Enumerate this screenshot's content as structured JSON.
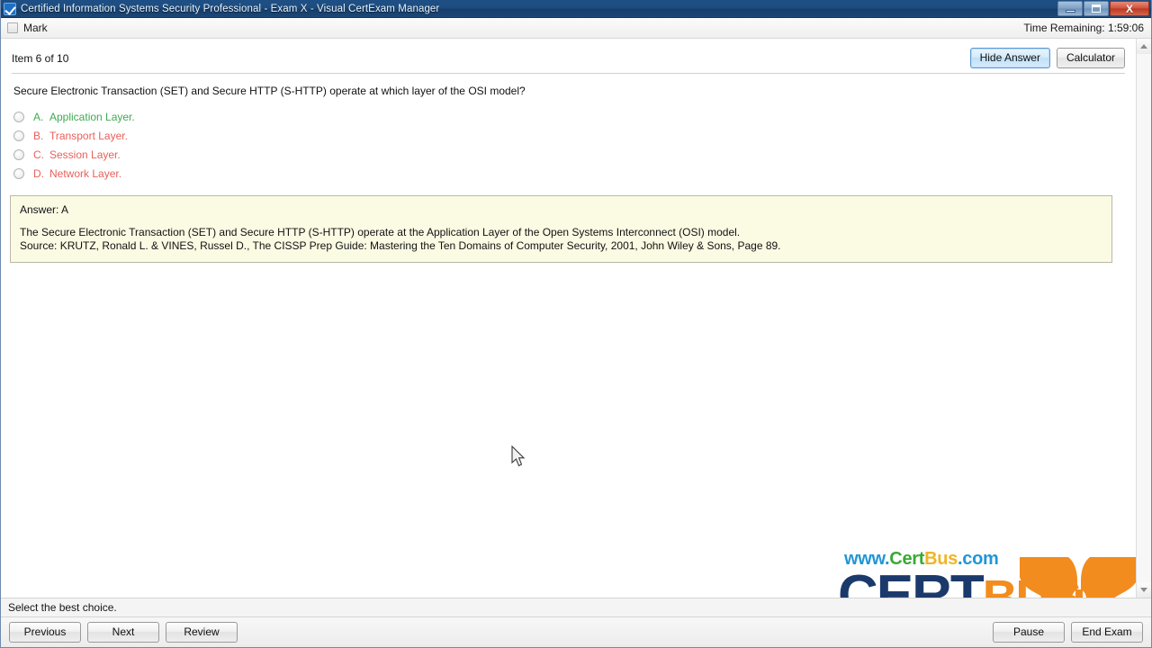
{
  "window": {
    "title": "Certified Information Systems Security Professional - Exam X - Visual CertExam Manager",
    "app_icon": "checkbox-icon",
    "minimize_label": "Minimize",
    "maximize_label": "Restore",
    "close_label": "X"
  },
  "toolbar": {
    "mark_label": "Mark",
    "time_remaining": "Time Remaining: 1:59:06"
  },
  "exam": {
    "item_counter": "Item 6 of 10",
    "hide_answer_label": "Hide Answer",
    "calculator_label": "Calculator",
    "question": "Secure Electronic Transaction (SET) and Secure HTTP (S-HTTP) operate at which layer of the OSI model?",
    "options": [
      {
        "letter": "A.",
        "text": "Application Layer.",
        "state": "correct",
        "color": "#3faa52",
        "selected": false
      },
      {
        "letter": "B.",
        "text": "Transport Layer.",
        "state": "wrong",
        "color": "#e8615c",
        "selected": false
      },
      {
        "letter": "C.",
        "text": "Session Layer.",
        "state": "wrong",
        "color": "#e8615c",
        "selected": false
      },
      {
        "letter": "D.",
        "text": "Network Layer.",
        "state": "wrong",
        "color": "#e8615c",
        "selected": false
      }
    ],
    "answer": {
      "heading": "Answer: A",
      "explanation": "The Secure Electronic Transaction (SET) and Secure HTTP (S-HTTP) operate at the Application Layer of the Open Systems Interconnect (OSI) model.",
      "source": "Source: KRUTZ, Ronald L. & VINES, Russel D., The CISSP Prep Guide: Mastering the Ten Domains of Computer Security, 2001, John Wiley & Sons, Page 89.",
      "background": "#fbfbe4",
      "border": "#b9b9a8"
    }
  },
  "logo": {
    "url_www": "www.",
    "url_cert": "Cert",
    "url_bus": "Bus",
    "url_com": ".com",
    "word_cert": "CERT",
    "word_bus": "BUS",
    "colors": {
      "url_www": "#2196d6",
      "url_cert": "#3aa935",
      "url_bus": "#f0b429",
      "url_com": "#2196d6",
      "word_cert": "#1b3a6b",
      "word_bus": "#f28c1e",
      "mark": "#f28c1e"
    }
  },
  "status": {
    "hint": "Select the best choice."
  },
  "nav": {
    "previous_label": "Previous",
    "next_label": "Next",
    "review_label": "Review",
    "pause_label": "Pause",
    "end_exam_label": "End Exam"
  }
}
